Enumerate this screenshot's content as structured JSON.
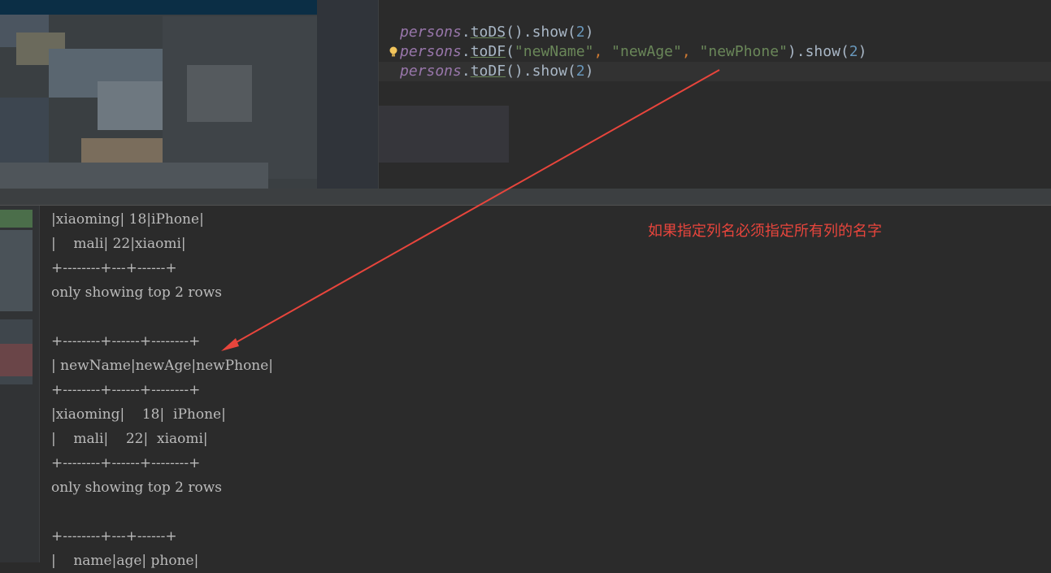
{
  "editor": {
    "lines": [
      {
        "var": "persons",
        "dot": ".",
        "method": "toDS",
        "paren_open": "().",
        "call": "show",
        "arg_open": "(",
        "arg": "2",
        "arg_close": ")"
      },
      {
        "var": "persons",
        "dot": ".",
        "method": "toDF",
        "paren_open": "(",
        "s1": "\"newName\"",
        "c1": ", ",
        "s2": "\"newAge\"",
        "c2": ", ",
        "s3": "\"newPhone\"",
        "close": ").",
        "call": "show",
        "arg_open": "(",
        "arg": "2",
        "arg_close": ")"
      },
      {
        "var": "persons",
        "dot": ".",
        "method": "toDF",
        "paren_open": "().",
        "call": "show",
        "arg_open": "(",
        "arg": "2",
        "arg_close": ")"
      }
    ]
  },
  "console": {
    "lines": [
      "|xiaoming| 18|iPhone|",
      "|    mali| 22|xiaomi|",
      "+--------+---+------+",
      "only showing top 2 rows",
      "",
      "+--------+------+--------+",
      "| newName|newAge|newPhone|",
      "+--------+------+--------+",
      "|xiaoming|    18|  iPhone|",
      "|    mali|    22|  xiaomi|",
      "+--------+------+--------+",
      "only showing top 2 rows",
      "",
      "+--------+---+------+",
      "|    name|age| phone|"
    ]
  },
  "annotation": "如果指定列名必须指定所有列的名字",
  "colors": {
    "annotation": "#e8453c",
    "keyword_var": "#9876aa",
    "string": "#6a8759",
    "number": "#6897bb"
  }
}
